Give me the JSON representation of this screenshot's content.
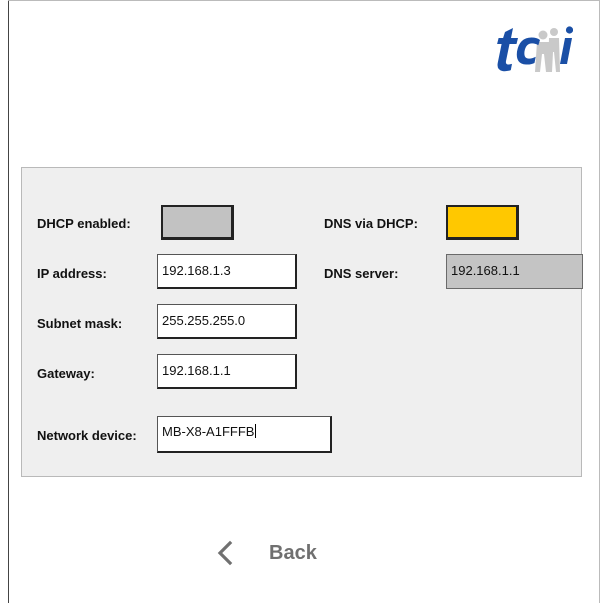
{
  "logo": {
    "text": "tcmi",
    "icon": "tcmi-logo",
    "color": "#1a4fa6"
  },
  "network": {
    "dhcp_enabled_label": "DHCP enabled:",
    "dhcp_enabled_state": "off",
    "dhcp_enabled_color": "#c2c2c2",
    "dns_via_dhcp_label": "DNS via DHCP:",
    "dns_via_dhcp_state": "on",
    "dns_via_dhcp_color": "#ffc800",
    "ip_label": "IP address:",
    "ip_value": "192.168.1.3",
    "dns_server_label": "DNS server:",
    "dns_server_value": "192.168.1.1",
    "subnet_label": "Subnet mask:",
    "subnet_value": "255.255.255.0",
    "gateway_label": "Gateway:",
    "gateway_value": "192.168.1.1",
    "device_label": "Network device:",
    "device_value": "MB-X8-A1FFFB"
  },
  "nav": {
    "back_label": "Back",
    "back_icon": "chevron-left-icon"
  }
}
